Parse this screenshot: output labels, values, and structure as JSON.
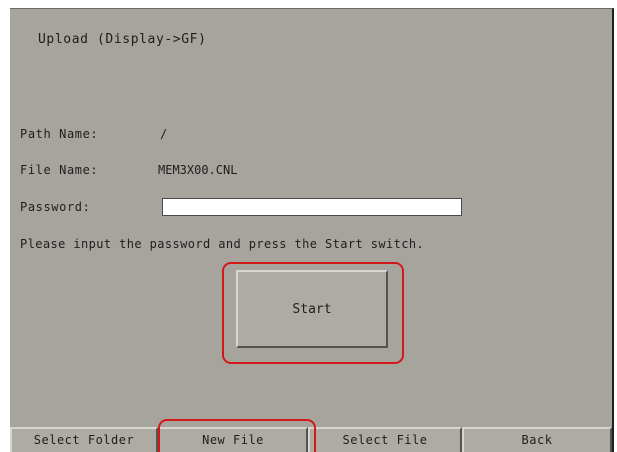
{
  "screen": {
    "title": "Upload (Display->GF)"
  },
  "form": {
    "path_label": "Path Name:",
    "path_value": "/",
    "file_label": "File Name:",
    "file_value": "MEM3X00.CNL",
    "password_label": "Password:",
    "password_value": "",
    "instruction": "Please input the password and press the Start switch."
  },
  "start_button": {
    "label": "Start"
  },
  "bottom_bar": {
    "select_folder": "Select Folder",
    "new_file": "New File",
    "select_file": "Select File",
    "back": "Back"
  },
  "colors": {
    "screen_background": "#a7a49e",
    "highlight": "#d11919",
    "input_background": "#ffffff"
  }
}
